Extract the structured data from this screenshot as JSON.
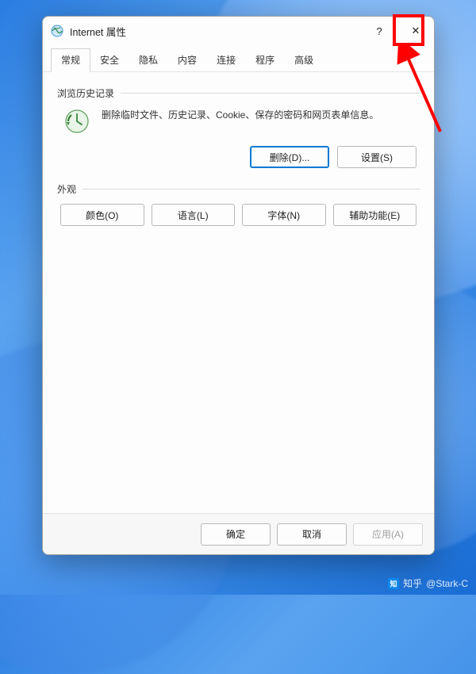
{
  "window": {
    "title": "Internet 属性",
    "help_symbol": "?",
    "close_symbol": "✕"
  },
  "tabs": [
    {
      "label": "常规",
      "active": true
    },
    {
      "label": "安全",
      "active": false
    },
    {
      "label": "隐私",
      "active": false
    },
    {
      "label": "内容",
      "active": false
    },
    {
      "label": "连接",
      "active": false
    },
    {
      "label": "程序",
      "active": false
    },
    {
      "label": "高级",
      "active": false
    }
  ],
  "history_group": {
    "title": "浏览历史记录",
    "description": "删除临时文件、历史记录、Cookie、保存的密码和网页表单信息。",
    "delete_btn": "删除(D)...",
    "settings_btn": "设置(S)"
  },
  "appearance_group": {
    "title": "外观",
    "colors_btn": "颜色(O)",
    "languages_btn": "语言(L)",
    "fonts_btn": "字体(N)",
    "accessibility_btn": "辅助功能(E)"
  },
  "footer": {
    "ok": "确定",
    "cancel": "取消",
    "apply": "应用(A)"
  },
  "watermark": {
    "site": "知乎",
    "author": "@Stark-C"
  },
  "annotation": {
    "highlights": "titlebar-help-button"
  }
}
